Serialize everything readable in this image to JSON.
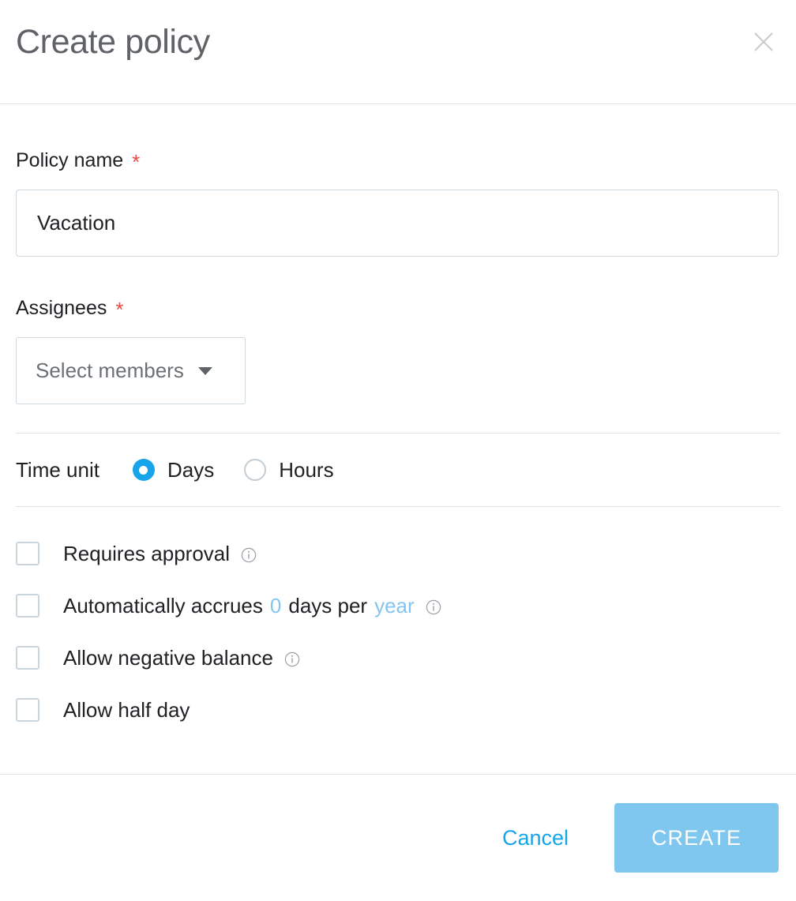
{
  "dialog": {
    "title": "Create policy",
    "close_label": "Close"
  },
  "policy_name": {
    "label": "Policy name",
    "required_mark": "*",
    "value": "Vacation",
    "placeholder": "Policy name"
  },
  "assignees": {
    "label": "Assignees",
    "required_mark": "*",
    "selected": "Select members"
  },
  "time_unit": {
    "label": "Time unit",
    "options": [
      {
        "label": "Days",
        "selected": true
      },
      {
        "label": "Hours",
        "selected": false
      }
    ]
  },
  "options": {
    "requires_approval": {
      "label": "Requires approval",
      "checked": false,
      "has_info": true
    },
    "auto_accrues": {
      "prefix": "Automatically accrues",
      "amount": "0",
      "middle": "days per",
      "period": "year",
      "checked": false,
      "has_info": true
    },
    "allow_negative_balance": {
      "label": "Allow negative balance",
      "checked": false,
      "has_info": true
    },
    "allow_half_day": {
      "label": "Allow half day",
      "checked": false,
      "has_info": false
    }
  },
  "footer": {
    "cancel_label": "Cancel",
    "create_label": "CREATE"
  },
  "colors": {
    "accent_blue": "#16a5ea",
    "light_blue": "#7fc7ee",
    "required_red": "#ea4a42",
    "border_gray": "#ced8de",
    "text_primary": "#202124",
    "text_muted": "#6b7075",
    "title_gray": "#5f6368"
  }
}
